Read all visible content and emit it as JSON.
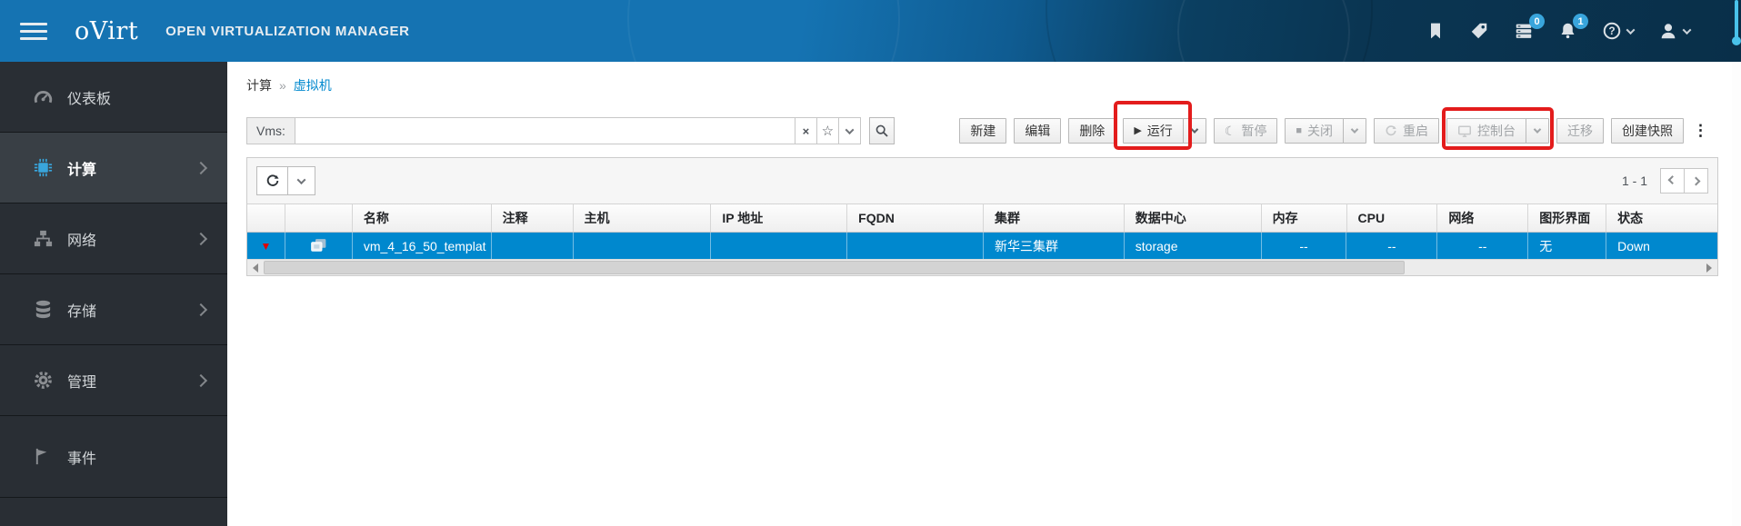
{
  "header": {
    "logo_text": "oVirt",
    "product_name": "OPEN VIRTUALIZATION MANAGER",
    "tasks_badge": "0",
    "alerts_badge": "1"
  },
  "sidebar": {
    "items": [
      {
        "label": "仪表板"
      },
      {
        "label": "计算"
      },
      {
        "label": "网络"
      },
      {
        "label": "存储"
      },
      {
        "label": "管理"
      },
      {
        "label": "事件"
      }
    ]
  },
  "breadcrumb": {
    "parent": "计算",
    "separator": "»",
    "current": "虚拟机"
  },
  "search": {
    "scope_label": "Vms:",
    "value": "",
    "clear_icon": "×",
    "star_icon": "☆"
  },
  "toolbar": {
    "new": "新建",
    "edit": "编辑",
    "delete": "删除",
    "run": "运行",
    "run_icon": "▶",
    "suspend": "暂停",
    "suspend_icon": "☾",
    "shutdown": "关闭",
    "shutdown_icon": "■",
    "reboot": "重启",
    "console": "控制台",
    "migrate": "迁移",
    "snapshot": "创建快照",
    "kebab_icon": "⋮"
  },
  "pagination": {
    "range": "1 - 1"
  },
  "grid": {
    "columns": [
      "名称",
      "注释",
      "主机",
      "IP 地址",
      "FQDN",
      "集群",
      "数据中心",
      "内存",
      "CPU",
      "网络",
      "图形界面",
      "状态"
    ],
    "row": {
      "status_icon": "▼",
      "name": "vm_4_16_50_templat",
      "comment": "",
      "host": "",
      "ip": "",
      "fqdn": "",
      "cluster": "新华三集群",
      "datacenter": "storage",
      "memory": "--",
      "cpu": "--",
      "network": "--",
      "graphics": "无",
      "status": "Down"
    }
  },
  "colors": {
    "selected_row_blue": "#0088ce",
    "link_blue": "#0088ce",
    "annotation_red": "#e31c1c",
    "badge_blue": "#39a5dc",
    "status_arrow_red": "#e40000",
    "masthead_blue": "#1573b2",
    "masthead_dark": "#092f49",
    "sidebar_dark": "#292e34"
  }
}
